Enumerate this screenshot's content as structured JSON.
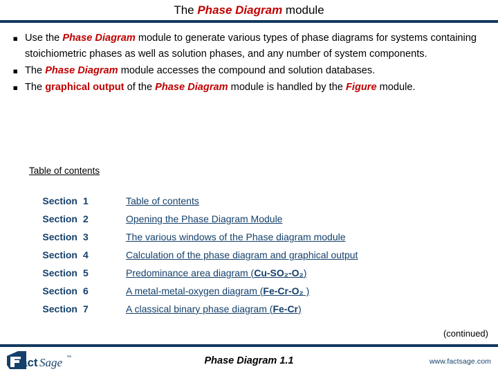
{
  "slide": {
    "title": {
      "pre": "The ",
      "highlight": "Phase Diagram",
      "post": " module"
    },
    "bullets": [
      {
        "marker": "▪",
        "segments": [
          {
            "text": "Use the ",
            "style": "plain"
          },
          {
            "text": "Phase Diagram",
            "style": "red-bold-italic"
          },
          {
            "text": " module to generate various types of phase diagrams for systems containing stoichiometric phases as well as solution phases, and any number of system components.",
            "style": "plain"
          }
        ]
      },
      {
        "marker": "▪",
        "segments": [
          {
            "text": "The ",
            "style": "plain"
          },
          {
            "text": "Phase Diagram",
            "style": "red-bold-italic"
          },
          {
            "text": " module accesses the compound and solution databases.",
            "style": "plain"
          }
        ]
      },
      {
        "marker": "▪",
        "segments": [
          {
            "text": "The ",
            "style": "plain"
          },
          {
            "text": "graphical output",
            "style": "red-bold"
          },
          {
            "text": " of the ",
            "style": "plain"
          },
          {
            "text": "Phase Diagram",
            "style": "red-bold-italic"
          },
          {
            "text": " module is handled by the ",
            "style": "plain"
          },
          {
            "text": "Figure",
            "style": "red-bold-italic"
          },
          {
            "text": " module.",
            "style": "plain"
          }
        ]
      }
    ],
    "toc_heading": "Table of contents",
    "toc": [
      {
        "label": "Section",
        "number": "1",
        "link_plain": "Table of contents",
        "link_formula": "",
        "link_tail": ""
      },
      {
        "label": "Section",
        "number": "2",
        "link_plain": "Opening the Phase Diagram Module",
        "link_formula": "",
        "link_tail": ""
      },
      {
        "label": "Section",
        "number": "3",
        "link_plain": "The various windows of the Phase diagram module",
        "link_formula": "",
        "link_tail": ""
      },
      {
        "label": "Section",
        "number": "4",
        "link_plain": "Calculation of the phase diagram and graphical output",
        "link_formula": "",
        "link_tail": ""
      },
      {
        "label": "Section",
        "number": "5",
        "link_plain": "Predominance area diagram  (",
        "link_formula": "Cu-SO₂-O₂",
        "link_tail": ")"
      },
      {
        "label": "Section",
        "number": "6",
        "link_plain": "A metal-metal-oxygen diagram  (",
        "link_formula": "Fe-Cr-O₂",
        "link_tail": " )"
      },
      {
        "label": "Section",
        "number": "7",
        "link_plain": "A classical binary phase diagram (",
        "link_formula": "Fe-Cr",
        "link_tail": ")"
      }
    ],
    "continued": "(continued)"
  },
  "footer": {
    "logo_fact": "Fact",
    "logo_sage": "Sage",
    "logo_tm": "™",
    "center_title": "Phase Diagram  1.1",
    "url": "www.factsage.com"
  },
  "colors": {
    "accent_red": "#c00000",
    "navy": "#14406b",
    "rule": "#13395e"
  }
}
